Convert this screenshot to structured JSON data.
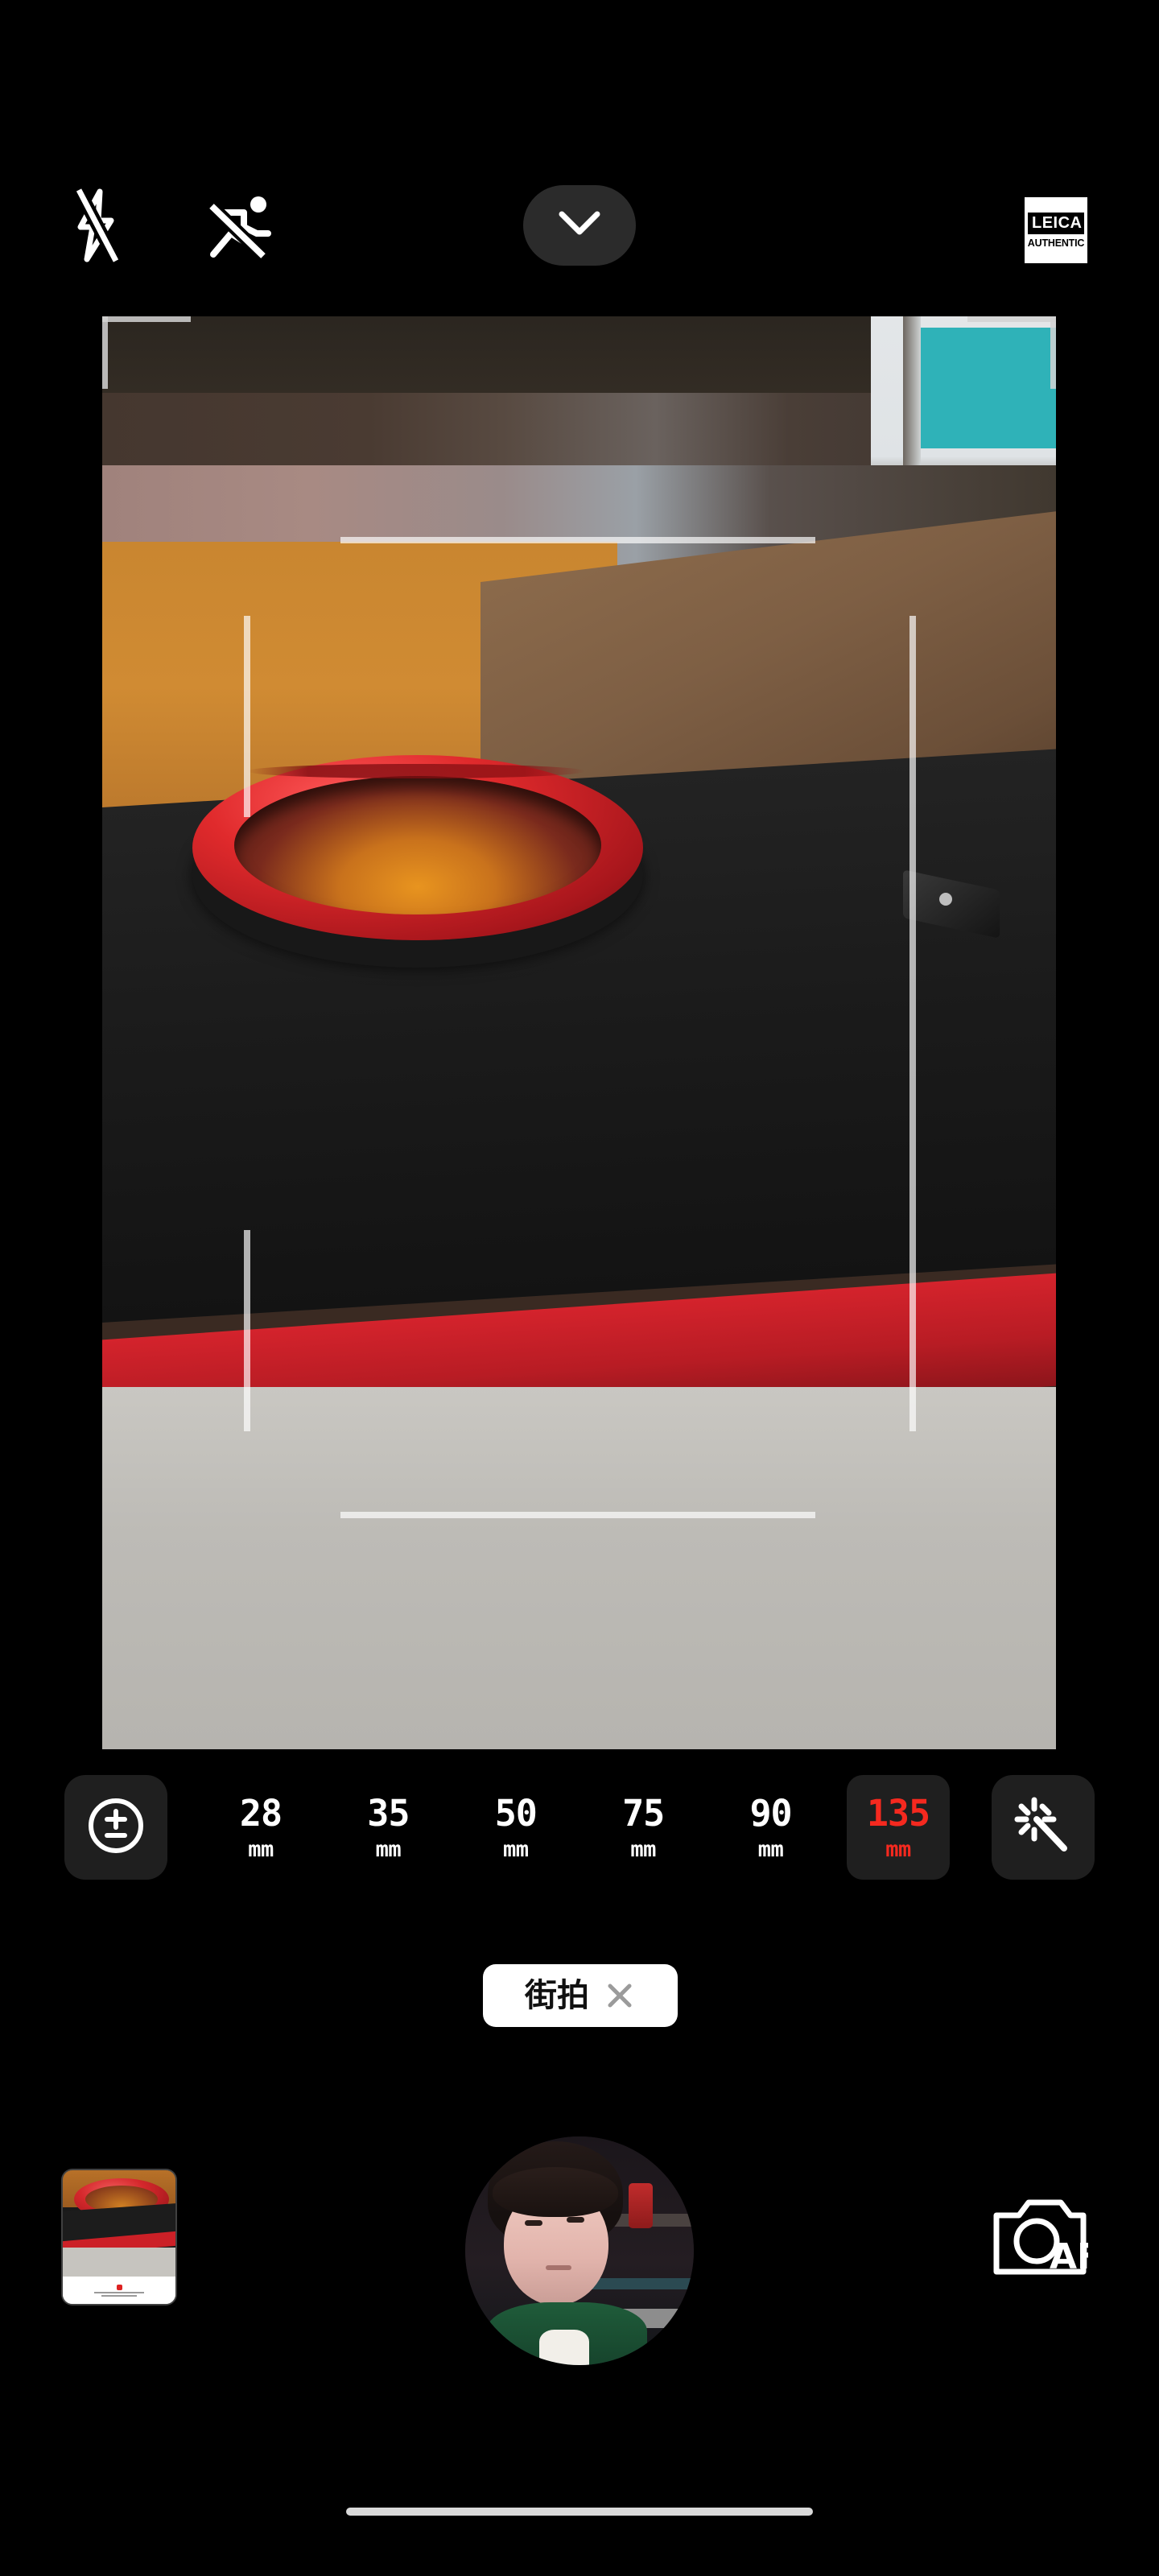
{
  "app": {
    "name": "Leica Camera",
    "mode": "photo",
    "accent_red": "#f5291f",
    "chip_bg": "#ffffff",
    "panel_bg": "#1f1f1f",
    "background": "#000000"
  },
  "topbar": {
    "flash": {
      "icon": "flash-off-icon",
      "state": "off",
      "label": "Flash off"
    },
    "motion": {
      "icon": "motion-capture-off-icon",
      "state": "off",
      "label": "Motion capture off"
    },
    "expand": {
      "icon": "chevron-down-icon",
      "label": "More settings"
    },
    "watermark": {
      "icon": "leica-authentic-badge",
      "line1": "LEICA",
      "line2": "AUTHENTIC"
    }
  },
  "viewfinder": {
    "label": "Camera preview",
    "aspect": "4:3 crop",
    "guides": {
      "visible": true,
      "color": "#ffffff",
      "type": "composition-framing-lines"
    },
    "scene_description": "Red anodized lens filter ring resting on a black camera bag with an orange wooden surface behind"
  },
  "focal_bar": {
    "exposure_button": {
      "icon": "exposure-compensation-icon",
      "label": "Exposure compensation"
    },
    "enhance_button": {
      "icon": "magic-wand-icon",
      "label": "AI enhance"
    },
    "unit": "mm",
    "selected": "135",
    "options": [
      {
        "value": "28",
        "unit": "mm",
        "selected": false
      },
      {
        "value": "35",
        "unit": "mm",
        "selected": false
      },
      {
        "value": "50",
        "unit": "mm",
        "selected": false
      },
      {
        "value": "75",
        "unit": "mm",
        "selected": false
      },
      {
        "value": "90",
        "unit": "mm",
        "selected": false
      },
      {
        "value": "135",
        "unit": "mm",
        "selected": true
      }
    ]
  },
  "filter_chip": {
    "label": "街拍",
    "close_icon": "close-icon",
    "close_label": "Remove filter"
  },
  "bottombar": {
    "thumbnail": {
      "name": "gallery-thumbnail",
      "label": "Last photo"
    },
    "shutter": {
      "name": "shutter-button",
      "label": "Capture",
      "preview": "front-camera-selfie-preview"
    },
    "switch_camera": {
      "icon": "camera-af-icon",
      "label": "AF",
      "hint": "Switch camera / autofocus"
    }
  },
  "system": {
    "home_indicator": "home-indicator"
  }
}
